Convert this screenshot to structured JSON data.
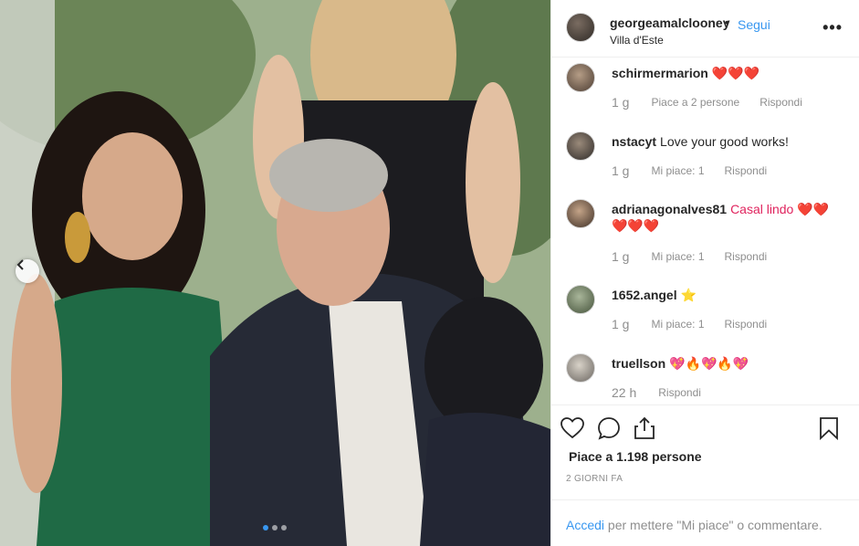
{
  "post": {
    "username": "georgeamalclooney",
    "follow_label": "Segui",
    "location": "Villa d'Este",
    "more_label": "•••"
  },
  "comments": [
    {
      "user": "schirmermarion",
      "text": "❤️❤️❤️",
      "time": "1 g",
      "likes": "Piace a 2 persone",
      "reply": "Rispondi"
    },
    {
      "user": "nstacyt",
      "text": "Love your good works!",
      "time": "1 g",
      "likes": "Mi piace: 1",
      "reply": "Rispondi"
    },
    {
      "user": "adrianagonalves81",
      "text": "Casal lindo ❤️❤️❤️❤️❤️",
      "time": "1 g",
      "likes": "Mi piace: 1",
      "reply": "Rispondi"
    },
    {
      "user": "1652.angel",
      "text": "⭐",
      "time": "1 g",
      "likes": "Mi piace: 1",
      "reply": "Rispondi"
    },
    {
      "user": "truellson",
      "text": "💖🔥💖🔥💖",
      "time": "22 h",
      "reply": "Rispondi"
    }
  ],
  "stats": {
    "likes_label": "Piace a 1.198 persone",
    "ago": "2 GIORNI FA"
  },
  "login": {
    "link": "Accedi",
    "rest": " per mettere \"Mi piace\" o commentare."
  },
  "icons": {
    "like": "heart-outline-icon",
    "comment": "comment-bubble-icon",
    "share": "share-icon",
    "save": "bookmark-icon",
    "prev": "chevron-left-icon"
  },
  "carousel": {
    "count": 3,
    "active_index": 0
  }
}
